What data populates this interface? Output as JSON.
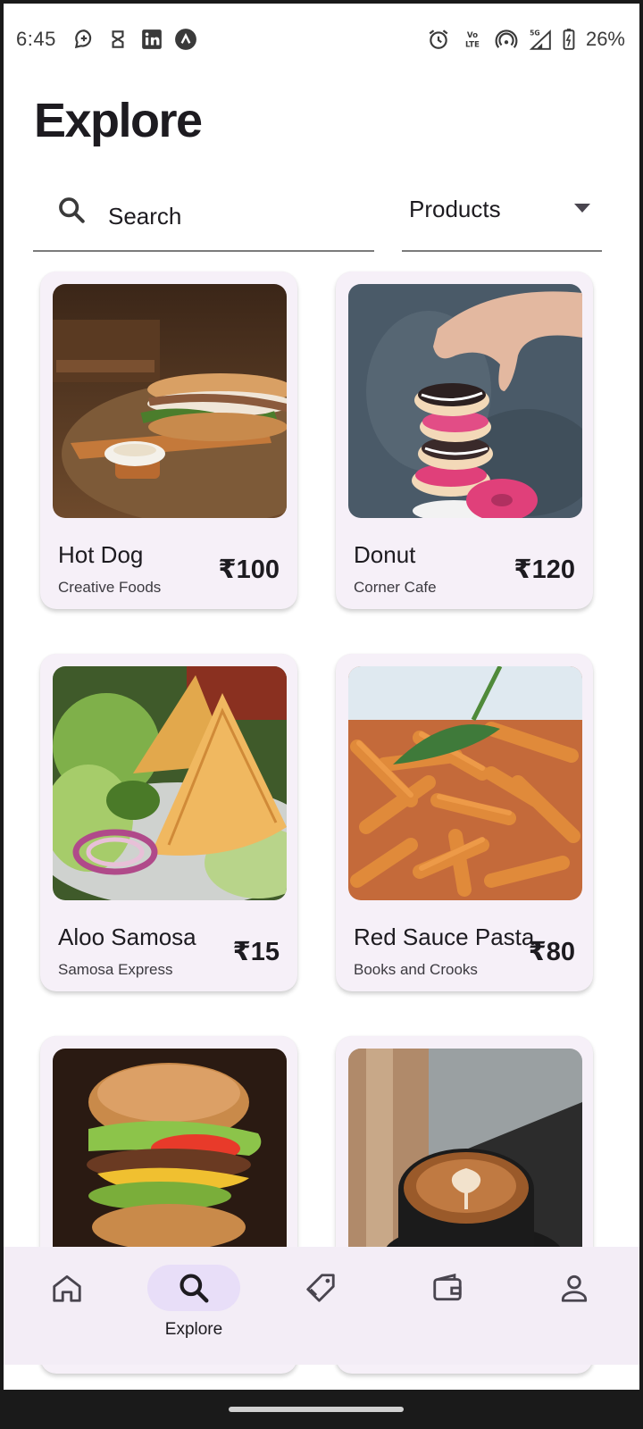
{
  "status_bar": {
    "time": "6:45",
    "battery": "26%",
    "left_icons": [
      "chat-icon",
      "storage-icon",
      "linkedin-icon",
      "app-icon"
    ],
    "right_icons": [
      "alarm-icon",
      "volte-icon",
      "hotspot-icon",
      "signal-icon",
      "battery-icon"
    ]
  },
  "page": {
    "title": "Explore"
  },
  "search": {
    "placeholder": "Search",
    "value": ""
  },
  "filter": {
    "selected": "Products"
  },
  "products": [
    {
      "name": "Hot Dog",
      "shop": "Creative Foods",
      "price": "₹100",
      "image": "hot-dog-photo"
    },
    {
      "name": "Donut",
      "shop": "Corner Cafe",
      "price": "₹120",
      "image": "donut-stack-photo"
    },
    {
      "name": "Aloo Samosa",
      "shop": "Samosa Express",
      "price": "₹15",
      "image": "samosa-photo"
    },
    {
      "name": "Red Sauce Pasta",
      "shop": "Books and Crooks",
      "price": "₹80",
      "image": "pasta-photo"
    },
    {
      "name": "",
      "shop": "",
      "price": "",
      "image": "burger-photo"
    },
    {
      "name": "",
      "shop": "",
      "price": "",
      "image": "coffee-photo"
    }
  ],
  "bottom_nav": [
    {
      "icon": "home-icon",
      "label": "",
      "active": false
    },
    {
      "icon": "search-icon",
      "label": "Explore",
      "active": true
    },
    {
      "icon": "tag-icon",
      "label": "",
      "active": false
    },
    {
      "icon": "wallet-icon",
      "label": "",
      "active": false
    },
    {
      "icon": "profile-icon",
      "label": "",
      "active": false
    }
  ],
  "colors": {
    "card_bg": "#f6f0f8",
    "nav_bg": "#f3edf6",
    "nav_active": "#e8def8",
    "text": "#1d1b20"
  }
}
